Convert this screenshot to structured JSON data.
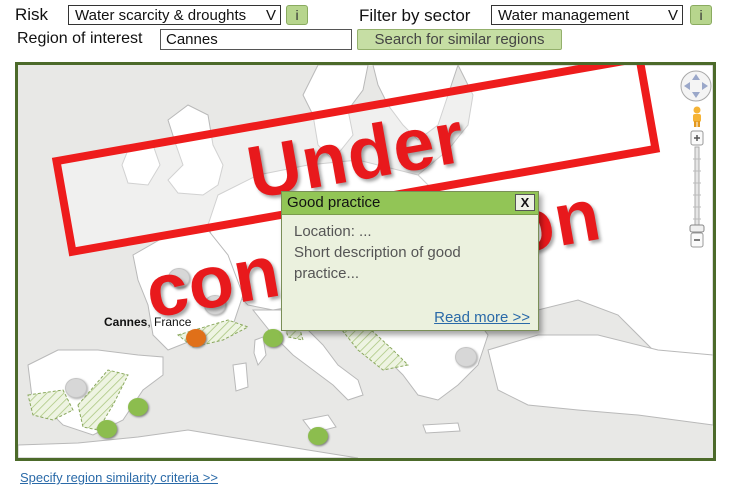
{
  "header": {
    "risk_label": "Risk",
    "risk_value": "Water scarcity & droughts",
    "select_arrow": "V",
    "info_label": "i",
    "sector_label": "Filter by sector",
    "sector_value": "Water management",
    "region_label": "Region of interest",
    "region_value": "Cannes",
    "search_button": "Search for similar regions"
  },
  "map": {
    "city_name": "Cannes",
    "city_country": ", France",
    "stamp_text": "Under construction",
    "colors": {
      "land": "#ffffff",
      "sea": "#e8e8e6",
      "frame": "#4c6a2a",
      "stamp": "#ee1c1c",
      "pin_green": "#8cbd4e",
      "pin_grey": "#d7d7d7",
      "pin_orange": "#e07019"
    },
    "icons": [
      "pan-control-icon",
      "pegman-icon",
      "zoom-in-icon",
      "zoom-out-icon",
      "zoom-slider-icon"
    ]
  },
  "popup": {
    "title": "Good practice",
    "close": "X",
    "location": "Location: ...",
    "description": "Short description  of good practice...",
    "read_more": "Read more >>"
  },
  "footer": {
    "criteria_link": "Specify region similarity criteria >>"
  }
}
